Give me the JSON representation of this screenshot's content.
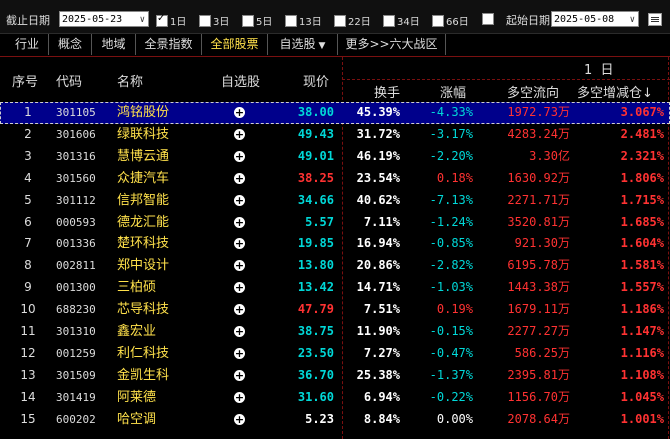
{
  "toolbar": {
    "end_date_label": "截止日期",
    "end_date": "2025-05-23",
    "periods": [
      {
        "label": "1日",
        "checked": true
      },
      {
        "label": "3日",
        "checked": false
      },
      {
        "label": "5日",
        "checked": false
      },
      {
        "label": "13日",
        "checked": false
      },
      {
        "label": "22日",
        "checked": false
      },
      {
        "label": "34日",
        "checked": false
      },
      {
        "label": "66日",
        "checked": false
      },
      {
        "label": "",
        "checked": false
      }
    ],
    "start_date_label": "起始日期",
    "start_date": "2025-05-08"
  },
  "tabs": [
    {
      "label": "行业",
      "active": false
    },
    {
      "label": "概念",
      "active": false
    },
    {
      "label": "地域",
      "active": false
    },
    {
      "label": "全景指数",
      "active": false
    },
    {
      "label": "全部股票",
      "active": true
    },
    {
      "label": "自选股",
      "active": false,
      "dropdown": "▼"
    },
    {
      "label": "更多>>六大战区",
      "active": false
    }
  ],
  "header": {
    "seq": "序号",
    "code": "代码",
    "name": "名称",
    "watch": "自选股",
    "price": "现价",
    "period": "1  日",
    "turnover": "换手",
    "change": "涨幅",
    "flow": "多空流向",
    "ratio": "多空增减仓↓"
  },
  "rows": [
    {
      "seq": "1",
      "code": "301105",
      "name": "鸿铭股份",
      "price": "38.00",
      "price_color": "cyan",
      "turnover": "45.39%",
      "change": "-4.33%",
      "change_color": "cyan",
      "flow": "1972.73万",
      "ratio": "3.067%"
    },
    {
      "seq": "2",
      "code": "301606",
      "name": "绿联科技",
      "price": "49.43",
      "price_color": "cyan",
      "turnover": "31.72%",
      "change": "-3.17%",
      "change_color": "cyan",
      "flow": "4283.24万",
      "ratio": "2.481%"
    },
    {
      "seq": "3",
      "code": "301316",
      "name": "慧博云通",
      "price": "49.01",
      "price_color": "cyan",
      "turnover": "46.19%",
      "change": "-2.20%",
      "change_color": "cyan",
      "flow": "3.30亿",
      "ratio": "2.321%"
    },
    {
      "seq": "4",
      "code": "301560",
      "name": "众捷汽车",
      "price": "38.25",
      "price_color": "red",
      "turnover": "23.54%",
      "change": "0.18%",
      "change_color": "red",
      "flow": "1630.92万",
      "ratio": "1.806%"
    },
    {
      "seq": "5",
      "code": "301112",
      "name": "信邦智能",
      "price": "34.66",
      "price_color": "cyan",
      "turnover": "40.62%",
      "change": "-7.13%",
      "change_color": "cyan",
      "flow": "2271.71万",
      "ratio": "1.715%"
    },
    {
      "seq": "6",
      "code": "000593",
      "name": "德龙汇能",
      "price": "5.57",
      "price_color": "cyan",
      "turnover": "7.11%",
      "change": "-1.24%",
      "change_color": "cyan",
      "flow": "3520.81万",
      "ratio": "1.685%"
    },
    {
      "seq": "7",
      "code": "001336",
      "name": "楚环科技",
      "price": "19.85",
      "price_color": "cyan",
      "turnover": "16.94%",
      "change": "-0.85%",
      "change_color": "cyan",
      "flow": "921.30万",
      "ratio": "1.604%"
    },
    {
      "seq": "8",
      "code": "002811",
      "name": "郑中设计",
      "price": "13.80",
      "price_color": "cyan",
      "turnover": "20.86%",
      "change": "-2.82%",
      "change_color": "cyan",
      "flow": "6195.78万",
      "ratio": "1.581%"
    },
    {
      "seq": "9",
      "code": "001300",
      "name": "三柏硕",
      "price": "13.42",
      "price_color": "cyan",
      "turnover": "14.71%",
      "change": "-1.03%",
      "change_color": "cyan",
      "flow": "1443.38万",
      "ratio": "1.557%"
    },
    {
      "seq": "10",
      "code": "688230",
      "name": "芯导科技",
      "price": "47.79",
      "price_color": "red",
      "turnover": "7.51%",
      "change": "0.19%",
      "change_color": "red",
      "flow": "1679.11万",
      "ratio": "1.186%"
    },
    {
      "seq": "11",
      "code": "301310",
      "name": "鑫宏业",
      "price": "38.75",
      "price_color": "cyan",
      "turnover": "11.90%",
      "change": "-0.15%",
      "change_color": "cyan",
      "flow": "2277.27万",
      "ratio": "1.147%"
    },
    {
      "seq": "12",
      "code": "001259",
      "name": "利仁科技",
      "price": "23.50",
      "price_color": "cyan",
      "turnover": "7.27%",
      "change": "-0.47%",
      "change_color": "cyan",
      "flow": "586.25万",
      "ratio": "1.116%"
    },
    {
      "seq": "13",
      "code": "301509",
      "name": "金凯生科",
      "price": "36.70",
      "price_color": "cyan",
      "turnover": "25.38%",
      "change": "-1.37%",
      "change_color": "cyan",
      "flow": "2395.81万",
      "ratio": "1.108%"
    },
    {
      "seq": "14",
      "code": "301419",
      "name": "阿莱德",
      "price": "31.60",
      "price_color": "cyan",
      "turnover": "6.94%",
      "change": "-0.22%",
      "change_color": "cyan",
      "flow": "1156.70万",
      "ratio": "1.045%"
    },
    {
      "seq": "15",
      "code": "600202",
      "name": "哈空调",
      "price": "5.23",
      "price_color": "white",
      "turnover": "8.84%",
      "change": "0.00%",
      "change_color": "white",
      "flow": "2078.64万",
      "ratio": "1.001%"
    }
  ]
}
